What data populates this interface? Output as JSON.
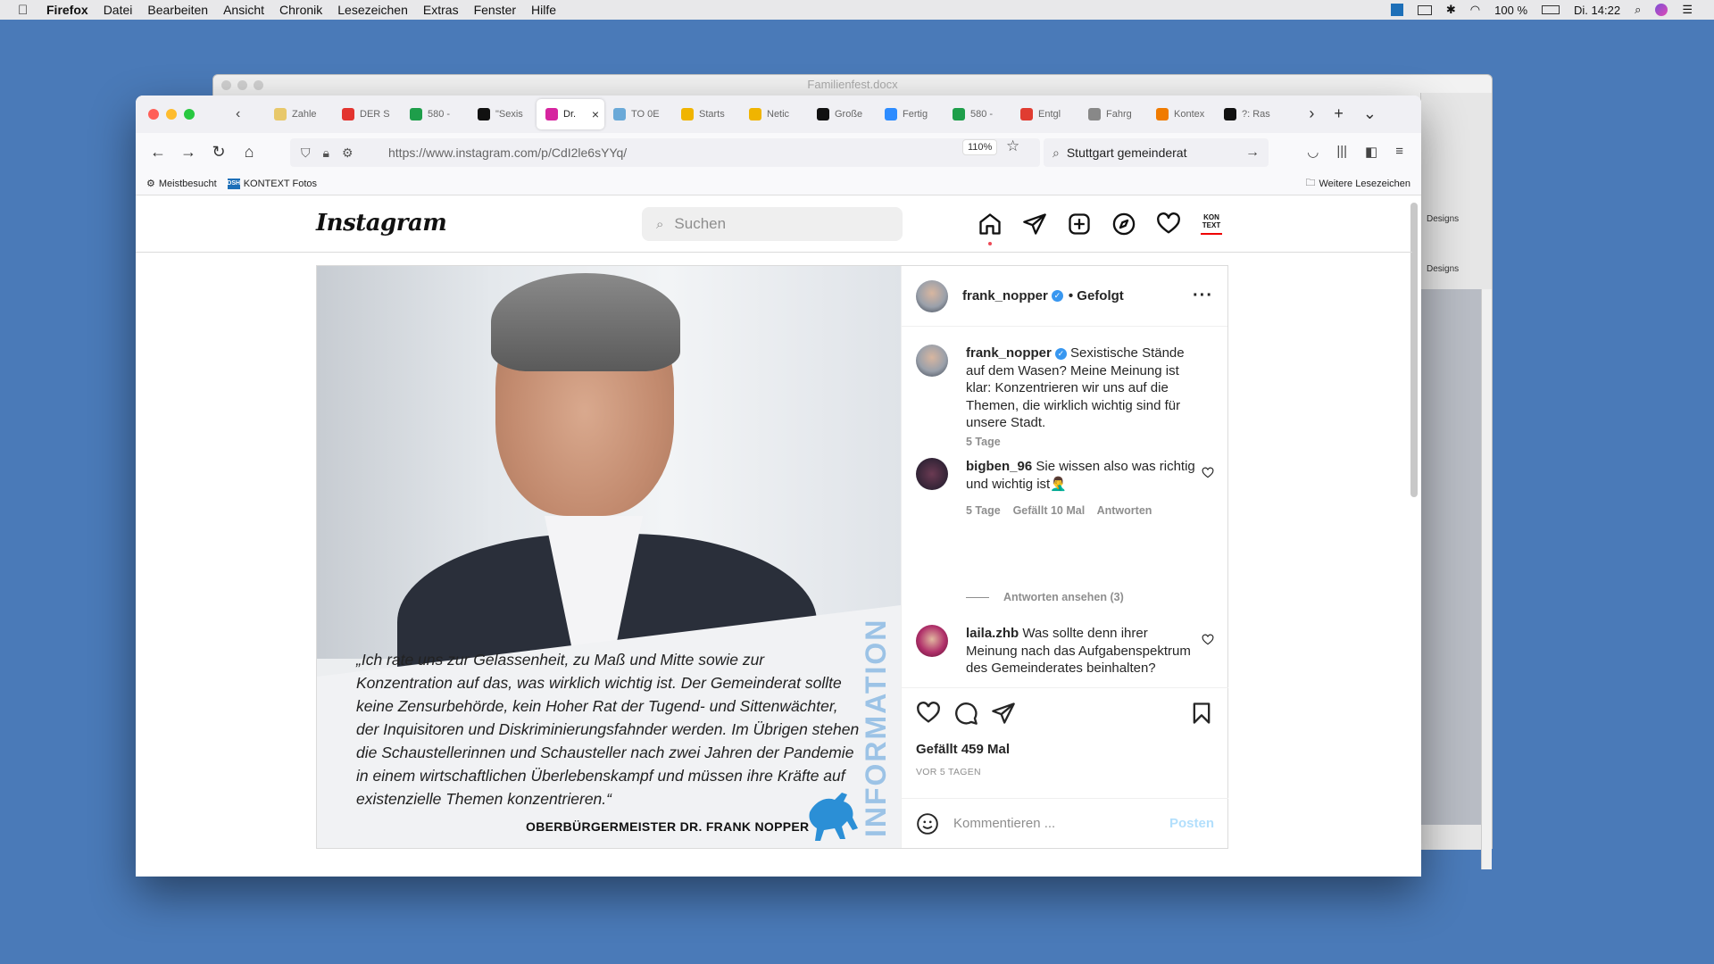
{
  "menubar": {
    "app": "Firefox",
    "items": [
      "Datei",
      "Bearbeiten",
      "Ansicht",
      "Chronik",
      "Lesezeichen",
      "Extras",
      "Fenster",
      "Hilfe"
    ],
    "battery": "100 %",
    "clock": "Di. 14:22"
  },
  "word": {
    "title": "Familienfest.docx",
    "designs1": "Designs",
    "designs2": "Designs"
  },
  "tabs": [
    {
      "label": "Zahle",
      "color": "#e8c86a"
    },
    {
      "label": "DER S",
      "color": "#e3342f"
    },
    {
      "label": "580 -",
      "color": "#1e9e4a"
    },
    {
      "label": "\"Sexis",
      "color": "#111111"
    },
    {
      "label": "Dr.",
      "color": "#d6249f",
      "active": true
    },
    {
      "label": "TO 0E",
      "color": "#6aa9d8"
    },
    {
      "label": "Starts",
      "color": "#f0b400"
    },
    {
      "label": "Netic",
      "color": "#f0b400"
    },
    {
      "label": "Große",
      "color": "#111111"
    },
    {
      "label": "Fertig",
      "color": "#2d8cff"
    },
    {
      "label": "580 -",
      "color": "#1e9e4a"
    },
    {
      "label": "Entgl",
      "color": "#e03c31"
    },
    {
      "label": "Fahrg",
      "color": "#888888"
    },
    {
      "label": "Kontex",
      "color": "#f07b00"
    },
    {
      "label": "?: Ras",
      "color": "#111111"
    }
  ],
  "toolbar": {
    "url": "https://www.instagram.com/p/CdI2le6sYYq/",
    "zoom": "110%",
    "search": "Stuttgart gemeinderat"
  },
  "bookmarks": {
    "most_visited": "Meistbesucht",
    "kontext_fotos": "KONTEXT Fotos",
    "more": "Weitere Lesezeichen",
    "badge": "DSH"
  },
  "instagram": {
    "logo": "Instagram",
    "search_placeholder": "Suchen",
    "kontext_icon": "KON TEXT"
  },
  "post": {
    "quote": "„Ich rate uns zur Gelassenheit, zu Maß und Mitte sowie zur Konzentration auf das, was wirklich wichtig ist. Der Gemeinderat sollte keine Zensurbehörde, kein Hoher Rat der Tugend- und Sittenwächter, der Inquisitoren und Diskriminierungsfahnder werden. Im Übrigen stehen die Schaustellerinnen und Schausteller nach zwei Jahren der Pandemie in einem wirtschaftlichen Überlebenskampf und müssen ihre Kräfte auf existenzielle Themen konzentrieren.“",
    "author": "OBERBÜRGERMEISTER DR. FRANK NOPPER",
    "vertical_label": "INFORMATION",
    "username": "frank_nopper",
    "followed": "• Gefolgt",
    "caption": "Sexistische Stände auf dem Wasen? Meine Meinung ist klar: Konzentrieren wir uns auf die Themen, die wirklich wichtig sind für unsere Stadt.",
    "caption_age": "5 Tage",
    "comments": [
      {
        "user": "bigben_96",
        "text": "Sie wissen also was richtig und wichtig ist🤦‍♂️",
        "age": "5 Tage",
        "likes": "Gefällt 10 Mal",
        "reply": "Antworten"
      },
      {
        "user": "laila.zhb",
        "text": "Was sollte denn ihrer Meinung nach das Aufgabenspektrum des Gemeinderates beinhalten?"
      }
    ],
    "view_replies": "Antworten ansehen (3)",
    "like_count": "Gefällt 459 Mal",
    "date": "VOR 5 TAGEN",
    "comment_placeholder": "Kommentieren ...",
    "post_button": "Posten"
  }
}
